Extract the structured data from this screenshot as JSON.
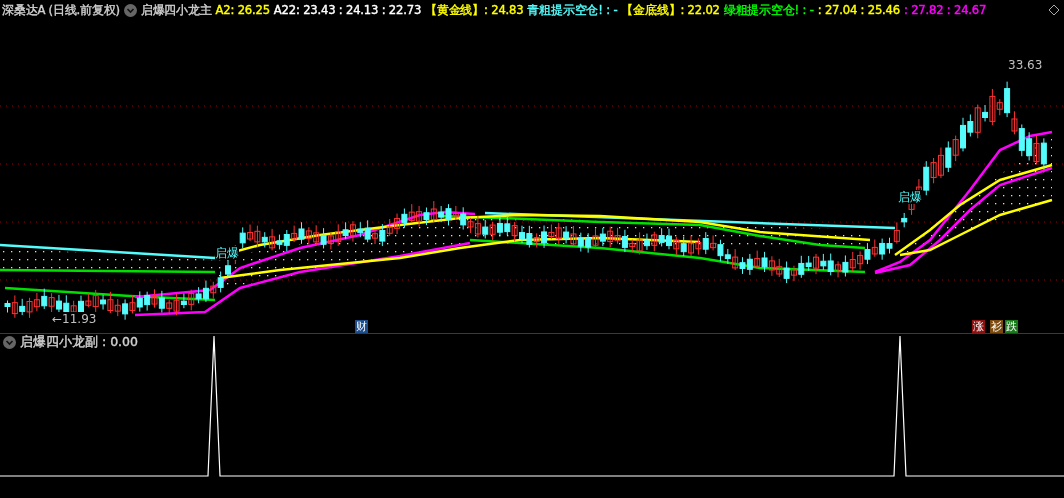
{
  "header": {
    "security": "深桑达A (日线.前复权)",
    "indicator": "启爆四小龙主",
    "values": [
      {
        "text": "A2: 26.25",
        "color": "#ffff00"
      },
      {
        "text": "A22: 23.43 : 24.13 : 22.73",
        "color": "#ffffff"
      },
      {
        "text": "【黄金线】: 24.83",
        "color": "#ffff00"
      },
      {
        "text": "青粗提示空仓! : -",
        "color": "#54fcfc"
      },
      {
        "text": "【金底线】: 22.02",
        "color": "#ffff00"
      },
      {
        "text": "绿粗提示空仓! : -",
        "color": "#00ff00"
      },
      {
        "text": ": 27.04 : 25.46",
        "color": "#ffff00"
      },
      {
        "text": ": 27.82 : 24.67",
        "color": "#ff00ff"
      }
    ]
  },
  "main_chart": {
    "low_label": "←11.93",
    "high_label": "33.63",
    "signals": [
      "启爆",
      "启爆"
    ],
    "badges": [
      {
        "text": "财",
        "color": "#1c4d8c"
      },
      {
        "text": "涨",
        "color": "#8c1010"
      },
      {
        "text": "衫",
        "color": "#7a4a10"
      },
      {
        "text": "跌",
        "color": "#1a7a1a"
      }
    ]
  },
  "sub_chart": {
    "title": "启爆四小龙副 : 0.00"
  }
}
